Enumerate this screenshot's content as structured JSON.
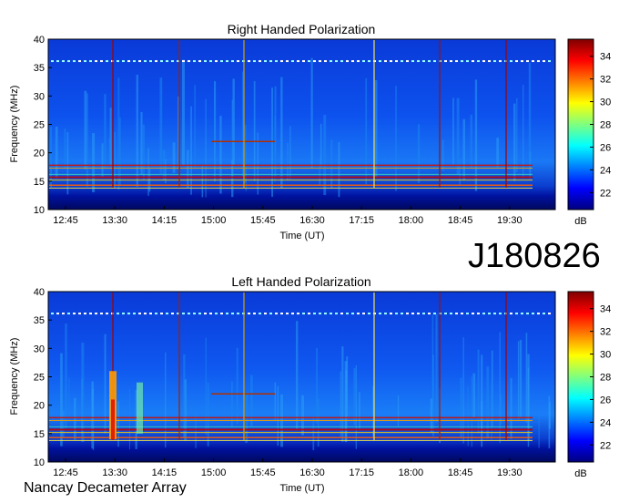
{
  "observation_id": "J180826",
  "footer": "Nancay Decameter Array",
  "chart_data": [
    {
      "type": "heatmap",
      "title": "Right Handed Polarization",
      "xlabel": "Time (UT)",
      "ylabel": "Frequency (MHz)",
      "x_ticks": [
        "12:45",
        "13:30",
        "14:15",
        "15:00",
        "15:45",
        "16:30",
        "17:15",
        "18:00",
        "18:45",
        "19:30"
      ],
      "y_ticks": [
        10,
        15,
        20,
        25,
        30,
        35,
        40
      ],
      "ylim": [
        10,
        40
      ],
      "colorbar_label": "dB",
      "colorbar_ticks": [
        22,
        24,
        26,
        28,
        30,
        32,
        34
      ],
      "colorbar_range": [
        20.5,
        35.5
      ],
      "colormap": [
        "#00007f",
        "#0000ff",
        "#007fff",
        "#00ffff",
        "#7fff7f",
        "#ffff00",
        "#ff7f00",
        "#ff0000",
        "#7f0000"
      ]
    },
    {
      "type": "heatmap",
      "title": "Left Handed Polarization",
      "xlabel": "Time (UT)",
      "ylabel": "Frequency (MHz)",
      "x_ticks": [
        "12:45",
        "13:30",
        "14:15",
        "15:00",
        "15:45",
        "16:30",
        "17:15",
        "18:00",
        "18:45",
        "19:30"
      ],
      "y_ticks": [
        10,
        15,
        20,
        25,
        30,
        35,
        40
      ],
      "ylim": [
        10,
        40
      ],
      "colorbar_label": "dB",
      "colorbar_ticks": [
        22,
        24,
        26,
        28,
        30,
        32,
        34
      ],
      "colorbar_range": [
        20.5,
        35.5
      ],
      "colormap": [
        "#00007f",
        "#0000ff",
        "#007fff",
        "#00ffff",
        "#7fff7f",
        "#ffff00",
        "#ff7f00",
        "#ff0000",
        "#7f0000"
      ]
    }
  ]
}
